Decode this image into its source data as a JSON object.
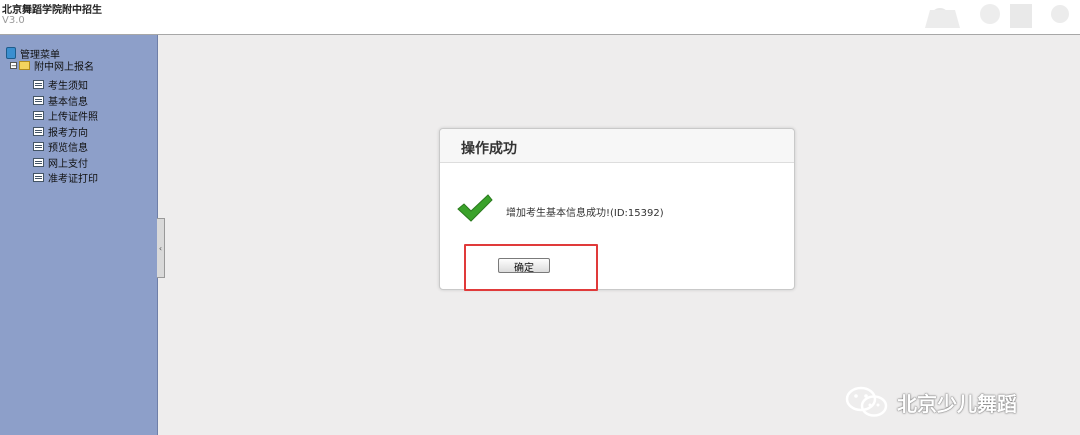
{
  "header": {
    "title": "北京舞蹈学院附中招生",
    "version": "V3.0"
  },
  "sidebar": {
    "root_label": "管理菜单",
    "group_label": "附中网上报名",
    "items": [
      {
        "label": "考生须知"
      },
      {
        "label": "基本信息"
      },
      {
        "label": "上传证件照"
      },
      {
        "label": "报考方向"
      },
      {
        "label": "预览信息"
      },
      {
        "label": "网上支付"
      },
      {
        "label": "准考证打印"
      }
    ]
  },
  "dialog": {
    "title": "操作成功",
    "message": "增加考生基本信息成功!(ID:15392)",
    "confirm_label": "确定"
  },
  "watermark": {
    "text": "北京少儿舞蹈"
  },
  "colors": {
    "sidebar_bg": "#8d9fc9",
    "highlight": "#e03a3a",
    "success_check": "#3aa22a"
  }
}
